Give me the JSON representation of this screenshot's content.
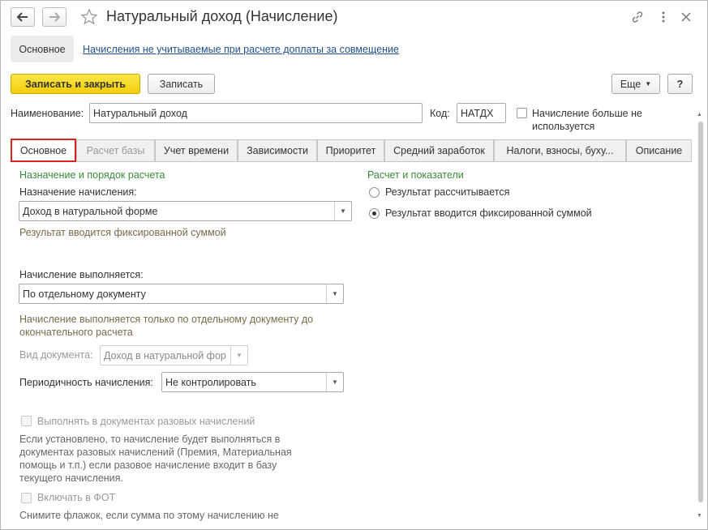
{
  "window": {
    "title": "Натуральный доход (Начисление)"
  },
  "nav_panel": {
    "items": [
      "Основное",
      "Начисления не учитываемые при расчете доплаты за совмещение"
    ]
  },
  "toolbar": {
    "save_close_label": "Записать и закрыть",
    "save_label": "Записать",
    "more_label": "Еще",
    "help_label": "?"
  },
  "header_fields": {
    "name_label": "Наименование:",
    "name_value": "Натуральный доход",
    "code_label": "Код:",
    "code_value": "НАТДХ",
    "unused_label_line1": "Начисление больше не",
    "unused_label_line2": "используется"
  },
  "tabs": [
    {
      "label": "Основное"
    },
    {
      "label": "Расчет базы"
    },
    {
      "label": "Учет времени"
    },
    {
      "label": "Зависимости"
    },
    {
      "label": "Приоритет"
    },
    {
      "label": "Средний заработок"
    },
    {
      "label": "Налоги, взносы, буху..."
    },
    {
      "label": "Описание"
    }
  ],
  "main": {
    "section_left_title": "Назначение и порядок расчета",
    "purpose_label": "Назначение начисления:",
    "purpose_value": "Доход в натуральной форме",
    "purpose_hint": "Результат вводится фиксированной суммой",
    "execution_label": "Начисление выполняется:",
    "execution_value": "По отдельному документу",
    "execution_hint_line1": "Начисление выполняется только по отдельному документу до",
    "execution_hint_line2": "окончательного расчета",
    "doc_type_label": "Вид документа:",
    "doc_type_value": "Доход в натуральной фор",
    "periodicity_label": "Периодичность начисления:",
    "periodicity_value": "Не контролировать",
    "one_time_label": "Выполнять в документах разовых начислений",
    "one_time_hint_line1": "Если установлено, то начисление будет выполняться в",
    "one_time_hint_line2": "документах разовых начислений (Премия, Материальная",
    "one_time_hint_line3": "помощь и т.п.) если разовое начисление входит в базу",
    "one_time_hint_line4": "текущего начисления.",
    "fot_label": "Включать в ФОТ",
    "fot_hint": "Снимите флажок, если сумма по этому начислению не",
    "section_right_title": "Расчет и показатели",
    "radio_calculated": "Результат рассчитывается",
    "radio_fixed": "Результат вводится фиксированной суммой"
  }
}
